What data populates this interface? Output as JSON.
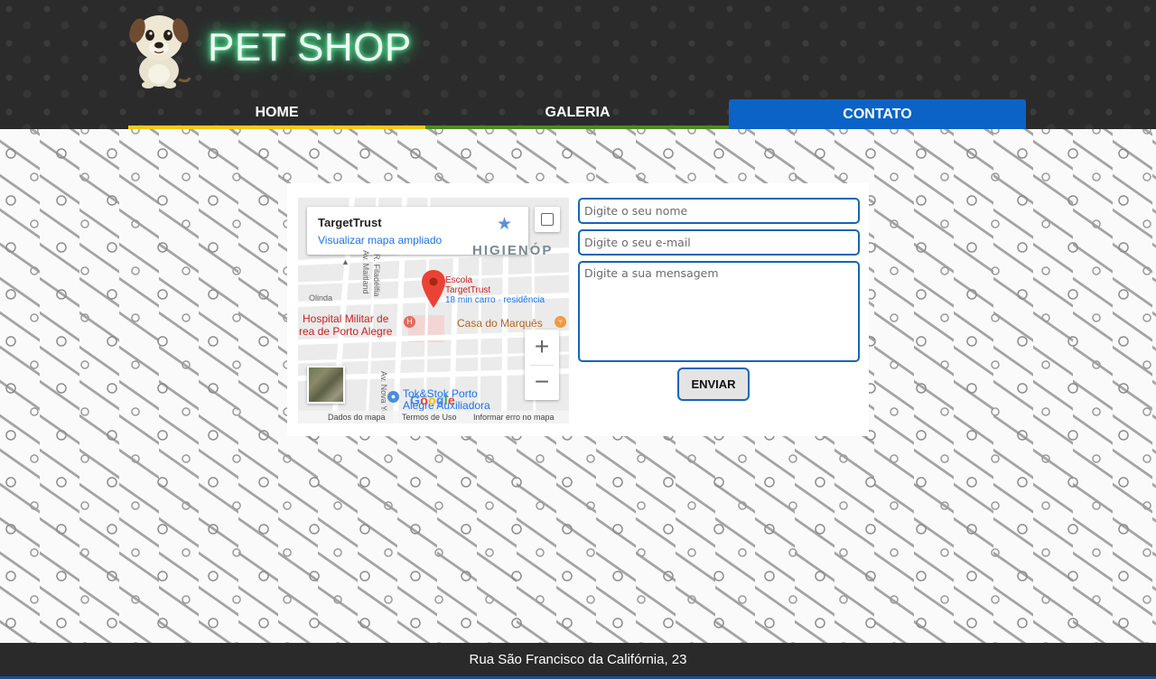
{
  "brand": {
    "name": "PET SHOP"
  },
  "nav": {
    "items": [
      {
        "label": "HOME"
      },
      {
        "label": "GALERIA"
      },
      {
        "label": "CONTATO"
      }
    ],
    "active": "CONTATO"
  },
  "map": {
    "place_name": "TargetTrust",
    "view_larger_link": "Visualizar mapa ampliado",
    "region_label": "HIGIENÓP",
    "pin_label_line1": "Escola",
    "pin_label_line2": "TargetTrust",
    "pin_label_line3": "18 min carro · residência",
    "poi_hospital_line1": "Hospital Militar de",
    "poi_hospital_line2": "rea de Porto Alegre",
    "poi_casa": "Casa do Marquês",
    "poi_tok_line1": "Tok&Stok Porto",
    "poi_tok_line2": "Alegre Auxiliadora",
    "street_maitland": "Av. Maitland",
    "street_filadelfia": "R. Filadélfia",
    "street_nova": "Av. Nova Yo",
    "street_olinda": "Olinda",
    "zoom_in": "+",
    "zoom_out": "−",
    "footer_data": "Dados do mapa",
    "footer_terms": "Termos de Uso",
    "footer_report": "Informar erro no mapa",
    "logo_text": [
      "G",
      "o",
      "o",
      "g",
      "l",
      "e"
    ]
  },
  "form": {
    "name_placeholder": "Digite o seu nome",
    "email_placeholder": "Digite o seu e-mail",
    "message_placeholder": "Digite a sua mensagem",
    "submit_label": "ENVIAR"
  },
  "footer": {
    "address": "Rua São Francisco da Califórnia, 23"
  },
  "colors": {
    "header_bg": "#2b2b2b",
    "home_underline": "#f2c81a",
    "galeria_underline": "#4d8a1e",
    "contato_active_bg": "#0b63c7",
    "field_border": "#1565b8",
    "brand_glow": "#3ee08a"
  },
  "icons": [
    "dog-mascot-icon",
    "star-icon",
    "fullscreen-icon",
    "map-pin-icon",
    "hospital-icon",
    "restaurant-icon",
    "store-icon",
    "zoom-in-icon",
    "zoom-out-icon"
  ]
}
